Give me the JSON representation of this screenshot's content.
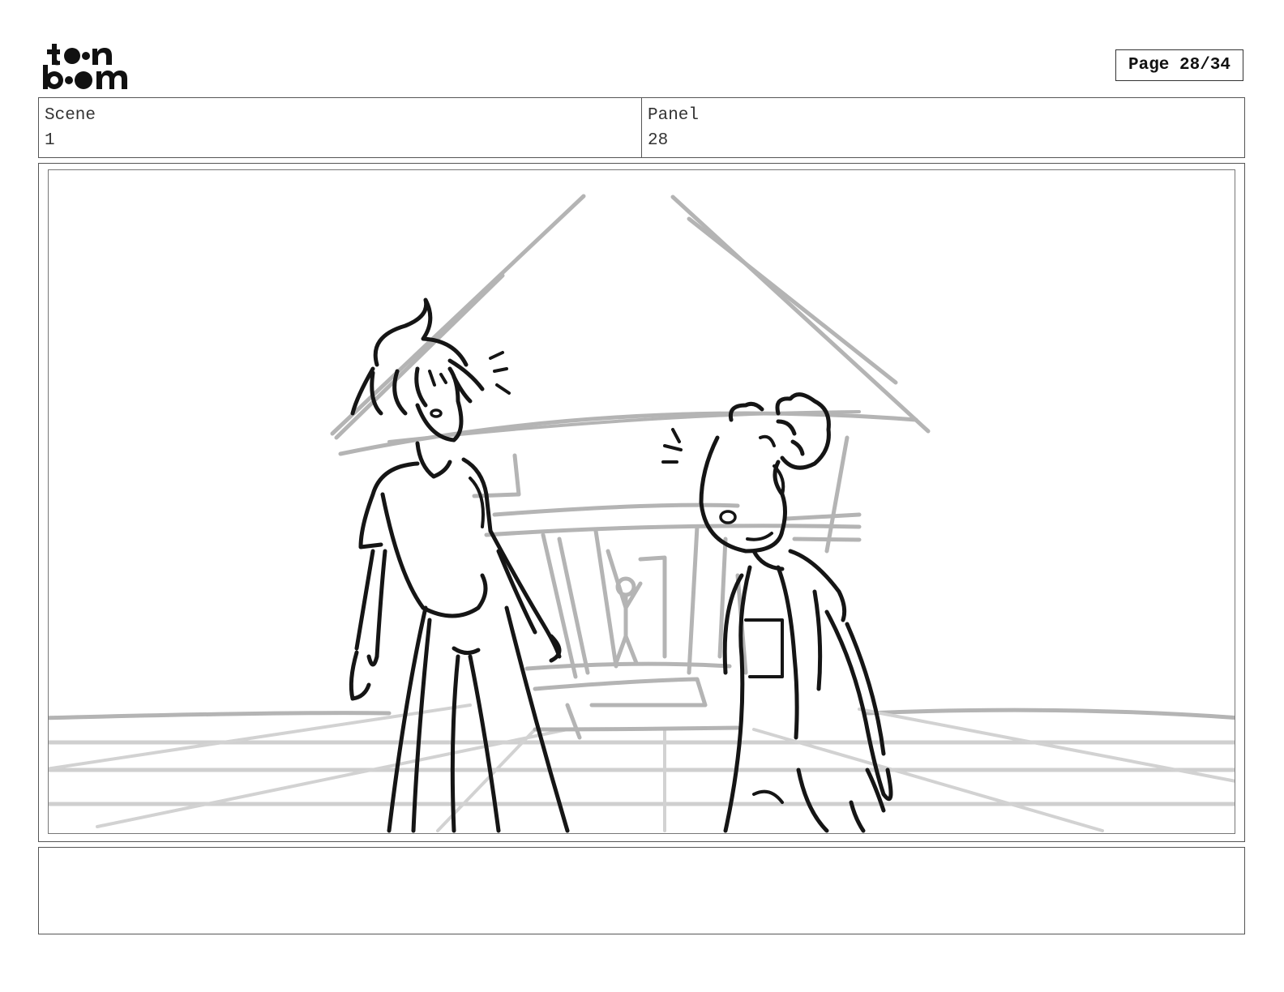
{
  "logo": {
    "brand_line1": "toon",
    "brand_line2": "boom"
  },
  "page": {
    "label": "Page 28/34"
  },
  "info": {
    "scene_label": "Scene",
    "scene_value": "1",
    "panel_label": "Panel",
    "panel_value": "28"
  },
  "panel_sketch": {
    "description_icon": "storyboard-sketch",
    "line_color": "#111111",
    "background_line_color": "#a8a8a8"
  },
  "notes": {
    "text": ""
  }
}
